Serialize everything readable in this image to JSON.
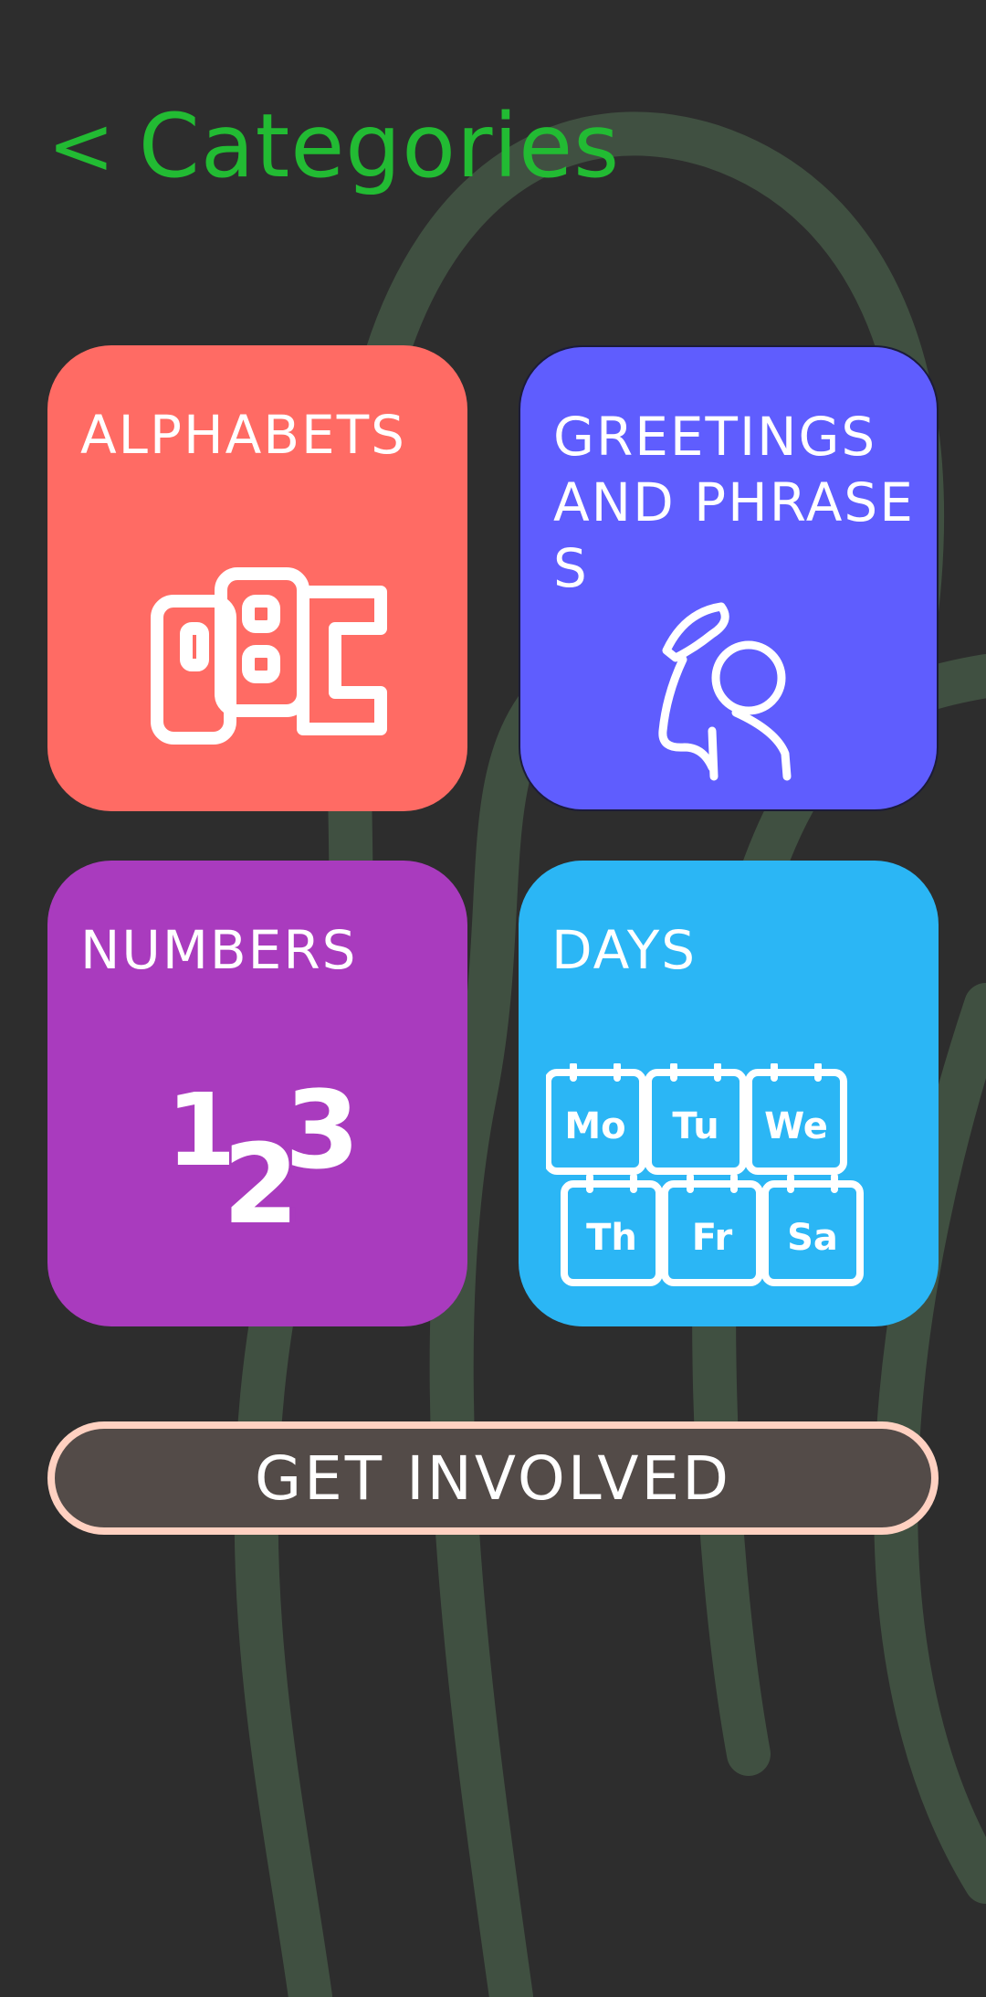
{
  "header": {
    "back_symbol": "<",
    "title": "Categories"
  },
  "categories": [
    {
      "label": "ALPHABETS",
      "icon": "abc-blocks-icon",
      "color": "#ff6b64"
    },
    {
      "label": "GREETINGS AND PHRASES",
      "icon": "waving-person-icon",
      "color": "#5f5dfe"
    },
    {
      "label": "NUMBERS",
      "icon": "numbers-123-icon",
      "color": "#a93bbe"
    },
    {
      "label": "DAYS",
      "icon": "calendar-days-icon",
      "color": "#2bb6f5"
    }
  ],
  "days_icon": {
    "days": [
      "Mo",
      "Tu",
      "We",
      "Th",
      "Fr",
      "Sa"
    ]
  },
  "numbers_icon": {
    "digits": [
      "1",
      "2",
      "3"
    ]
  },
  "cta": {
    "label": "GET INVOLVED"
  },
  "colors": {
    "background": "#2d2d2d",
    "accent": "#22bb33",
    "swirl": "#3f4f40",
    "cta_border": "#ffd1c1"
  }
}
